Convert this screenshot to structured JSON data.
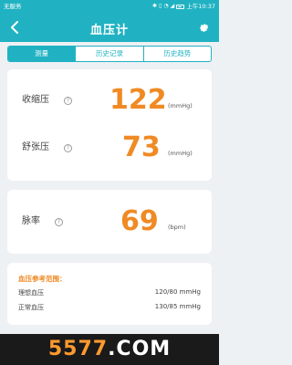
{
  "status_bar": {
    "carrier": "无服务",
    "time": "上午10:37",
    "icons": [
      "bluetooth-icon",
      "vibrate-icon",
      "wifi-icon",
      "signal-icon",
      "battery-icon"
    ]
  },
  "header": {
    "title": "血压计",
    "back_icon": "chevron-left-icon",
    "settings_icon": "gear-icon"
  },
  "tabs": [
    {
      "label": "测量",
      "active": true
    },
    {
      "label": "历史记录",
      "active": false
    },
    {
      "label": "历史趋势",
      "active": false
    }
  ],
  "metrics": {
    "systolic": {
      "label": "收缩压",
      "value": "122",
      "unit": "(mmHg)"
    },
    "diastolic": {
      "label": "舒张压",
      "value": "73",
      "unit": "(mmHg)"
    },
    "pulse": {
      "label": "脉率",
      "value": "69",
      "unit": "(bpm)"
    }
  },
  "reference": {
    "title": "血压参考范围：",
    "rows": [
      {
        "name": "理想血压",
        "value": "120/80 mmHg"
      },
      {
        "name": "正常血压",
        "value": "130/85 mmHg"
      }
    ]
  },
  "watermark": {
    "number": "5577",
    "dot": ".",
    "domain": "COM"
  },
  "colors": {
    "accent": "#20b2c2",
    "value": "#f08a24",
    "background": "#eef1f4"
  }
}
